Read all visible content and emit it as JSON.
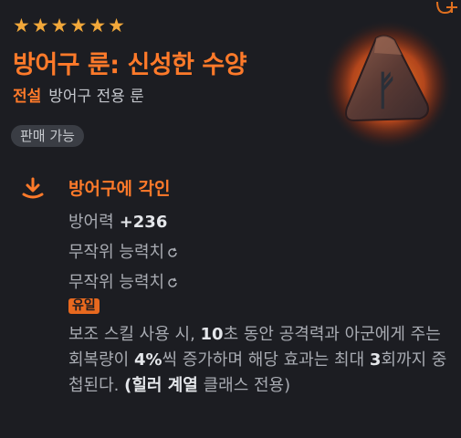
{
  "item": {
    "stars": 6,
    "name": "방어구 룬: 신성한 수양",
    "grade": "전설",
    "subtype": "방어구 전용 룬",
    "sell_badge": "판매 가능",
    "rune_glyph": "ᚠ",
    "colors": {
      "accent": "#ff7a2a",
      "star": "#f2a83a",
      "background": "#1c1d22"
    }
  },
  "engrave": {
    "title": "방어구에 각인",
    "defense_label": "방어력",
    "defense_value": "+236",
    "random_stat_1": "무작위 능력치",
    "random_stat_2": "무작위 능력치",
    "unique_tag": "유일",
    "desc_parts": {
      "a": "보조 스킬 사용 시, ",
      "b": "10",
      "c": "초 동안 공격력과 아군에게 주는 회복량이 ",
      "d": "4%",
      "e": "씩 증가하며 해당 효과는 최대 ",
      "f": "3",
      "g": "회까지 중첩된다. ",
      "h": "(힐러 계열",
      "i": " 클래스 전용)"
    }
  }
}
